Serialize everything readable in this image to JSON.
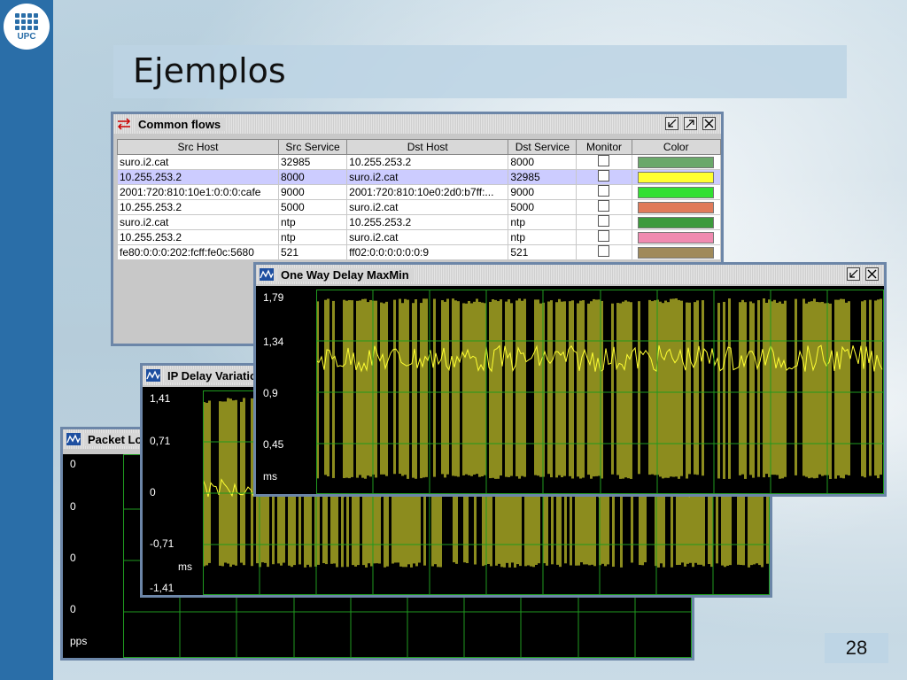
{
  "slide": {
    "title": "Ejemplos",
    "page_number": "28",
    "logo_text": "UPC"
  },
  "common_flows": {
    "title": "Common flows",
    "columns": [
      "Src Host",
      "Src Service",
      "Dst Host",
      "Dst Service",
      "Monitor",
      "Color"
    ],
    "rows": [
      {
        "src_host": "suro.i2.cat",
        "src_service": "32985",
        "dst_host": "10.255.253.2",
        "dst_service": "8000",
        "color": "#6aa86a"
      },
      {
        "src_host": "10.255.253.2",
        "src_service": "8000",
        "dst_host": "suro.i2.cat",
        "dst_service": "32985",
        "color": "#ffff33"
      },
      {
        "src_host": "2001:720:810:10e1:0:0:0:cafe",
        "src_service": "9000",
        "dst_host": "2001:720:810:10e0:2d0:b7ff:...",
        "dst_service": "9000",
        "color": "#33e033"
      },
      {
        "src_host": "10.255.253.2",
        "src_service": "5000",
        "dst_host": "suro.i2.cat",
        "dst_service": "5000",
        "color": "#e07a5a"
      },
      {
        "src_host": "suro.i2.cat",
        "src_service": "ntp",
        "dst_host": "10.255.253.2",
        "dst_service": "ntp",
        "color": "#3c9a3c"
      },
      {
        "src_host": "10.255.253.2",
        "src_service": "ntp",
        "dst_host": "suro.i2.cat",
        "dst_service": "ntp",
        "color": "#f08ab0"
      },
      {
        "src_host": "fe80:0:0:0:202:fcff:fe0c:5680",
        "src_service": "521",
        "dst_host": "ff02:0:0:0:0:0:0:9",
        "dst_service": "521",
        "color": "#a08a5a"
      }
    ],
    "selected_row": 1
  },
  "owd_window": {
    "title": "One Way Delay MaxMin",
    "y_labels": [
      "1,79",
      "1,34",
      "0,9",
      "0,45",
      "ms"
    ],
    "colors": {
      "trace": "#8c8c1e",
      "line": "#ffff33",
      "grid": "#1f9a1f"
    }
  },
  "ipdv_window": {
    "title": "IP Delay Variatio",
    "y_labels": [
      "1,41",
      "0,71",
      "0",
      "-0,71",
      "ms",
      "-1,41"
    ]
  },
  "packet_window": {
    "title": "Packet Lo",
    "y_labels": [
      "0",
      "0",
      "0",
      "0",
      "pps"
    ]
  },
  "icons": {
    "flows": "arrows-icon",
    "chart": "chart-icon",
    "minimize": "minimize-icon",
    "maximize": "maximize-icon",
    "close": "close-icon"
  }
}
